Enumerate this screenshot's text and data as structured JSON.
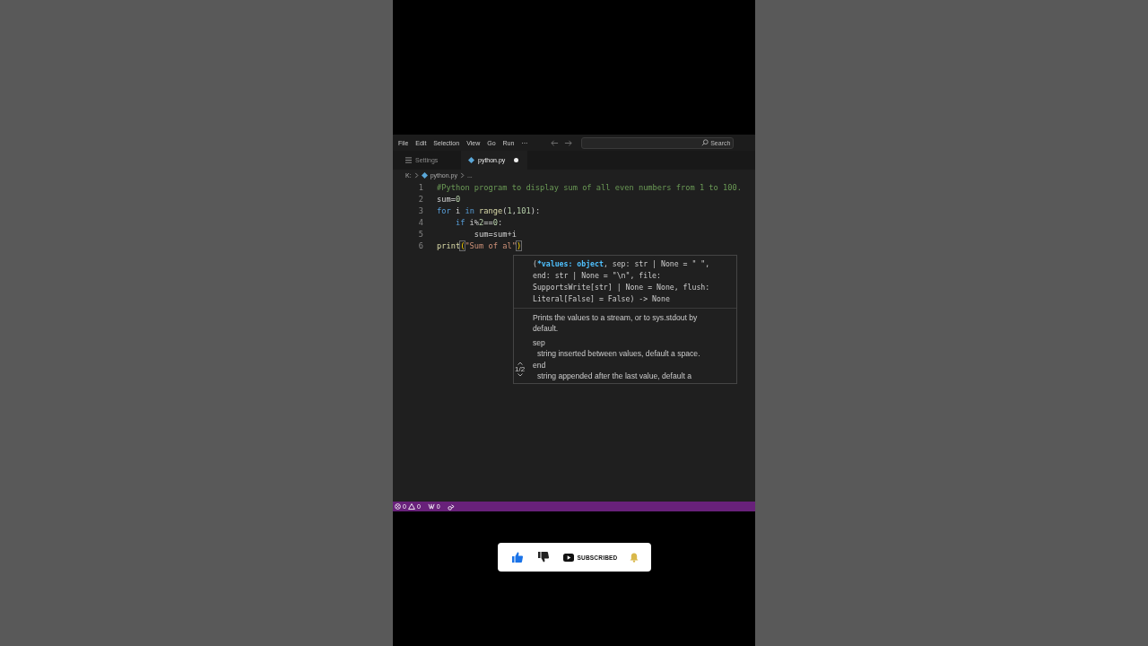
{
  "menu_bar": {
    "items": [
      "File",
      "Edit",
      "Selection",
      "View",
      "Go",
      "Run",
      "···"
    ],
    "search": {
      "placeholder": "Search"
    }
  },
  "tabs": [
    {
      "label": "Settings",
      "kind": "settings",
      "selected": false,
      "modified": false
    },
    {
      "label": "python.py",
      "kind": "python",
      "selected": true,
      "modified": true
    }
  ],
  "breadcrumb": [
    "K:",
    "python.py",
    "..."
  ],
  "editor": {
    "lines": [
      {
        "number": "1",
        "tokens": [
          {
            "text": "#Python program to display sum of all even numbers from 1 to 100.",
            "kind": "comment"
          }
        ]
      },
      {
        "number": "2",
        "tokens": [
          {
            "text": "sum",
            "kind": "plain"
          },
          {
            "text": "=",
            "kind": "plain"
          },
          {
            "text": "0",
            "kind": "number"
          }
        ]
      },
      {
        "number": "3",
        "tokens": [
          {
            "text": "for",
            "kind": "keyword"
          },
          {
            "text": " i ",
            "kind": "plain"
          },
          {
            "text": "in",
            "kind": "keyword"
          },
          {
            "text": " range",
            "kind": "function"
          },
          {
            "text": "(",
            "kind": "plain"
          },
          {
            "text": "1",
            "kind": "number"
          },
          {
            "text": ",",
            "kind": "plain"
          },
          {
            "text": "101",
            "kind": "number"
          },
          {
            "text": "):",
            "kind": "plain"
          }
        ]
      },
      {
        "number": "4",
        "tokens": [
          {
            "text": "    if",
            "kind": "keyword"
          },
          {
            "text": " i%",
            "kind": "plain"
          },
          {
            "text": "2",
            "kind": "number"
          },
          {
            "text": "==",
            "kind": "plain"
          },
          {
            "text": "0",
            "kind": "number"
          },
          {
            "text": ":",
            "kind": "plain"
          }
        ]
      },
      {
        "number": "5",
        "tokens": [
          {
            "text": "        sum=sum+i",
            "kind": "plain"
          }
        ]
      },
      {
        "number": "6",
        "tokens": [
          {
            "text": "print",
            "kind": "function"
          },
          {
            "text": "(",
            "kind": "bracket-match"
          },
          {
            "text": "\"Sum of al\"",
            "kind": "string"
          },
          {
            "text": ")",
            "kind": "bracket-match"
          }
        ]
      }
    ]
  },
  "hover": {
    "signature": [
      [
        {
          "text": "(",
          "kind": "plain"
        },
        {
          "text": "*values: object",
          "kind": "param"
        },
        {
          "text": ", sep: str | None = \" \",",
          "kind": "plain"
        }
      ],
      [
        {
          "text": "end: str | None = \"\\n\", file:",
          "kind": "plain"
        }
      ],
      [
        {
          "text": "SupportsWrite[str] | None = None, flush:",
          "kind": "plain"
        }
      ],
      [
        {
          "text": "Literal[False] = False) -> None",
          "kind": "plain"
        }
      ]
    ],
    "description": "Prints the values to a stream, or to sys.stdout by default.",
    "params": [
      {
        "name": "sep",
        "text": "string inserted between values, default a space."
      },
      {
        "name": "end",
        "text": "string appended after the last value, default a"
      }
    ],
    "counter": "1/2"
  },
  "status_bar": {
    "errors": "0",
    "warnings": "0",
    "ports": "0"
  },
  "overlay": {
    "like": {
      "selected": true
    },
    "dislike": {
      "selected": false
    },
    "subscribe": {
      "label": "SUBSCRIBED"
    }
  }
}
